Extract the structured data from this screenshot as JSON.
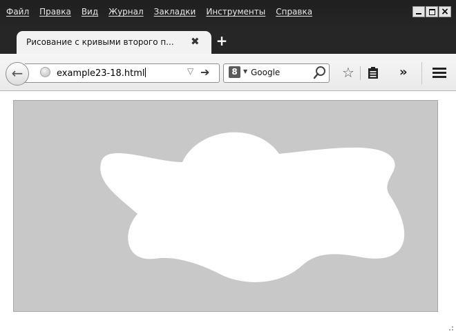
{
  "menu": {
    "items": [
      "Файл",
      "Правка",
      "Вид",
      "Журнал",
      "Закладки",
      "Инструменты",
      "Справка"
    ]
  },
  "tab": {
    "title": "Рисование с кривыми второго п...",
    "close_glyph": "✖",
    "new_tab_glyph": "+"
  },
  "navbar": {
    "back_glyph": "←",
    "url": "example23-18.html",
    "url_dropdown_glyph": "▽",
    "go_glyph": "➔",
    "search_engine_glyph": "8",
    "search_engine_caret": "▼",
    "search_engine": "Google",
    "bookmark_glyph": "☆",
    "overflow_glyph": "»"
  },
  "window_controls": {
    "close_glyph": "×"
  },
  "colors": {
    "titlebar": "#1f1f1f",
    "canvas_background": "#c8c8c8",
    "shape_fill": "#ffffff"
  },
  "icons": [
    "globe-icon",
    "search-icon",
    "bookmarks-icon",
    "menu-icon",
    "resize-grip-icon"
  ]
}
